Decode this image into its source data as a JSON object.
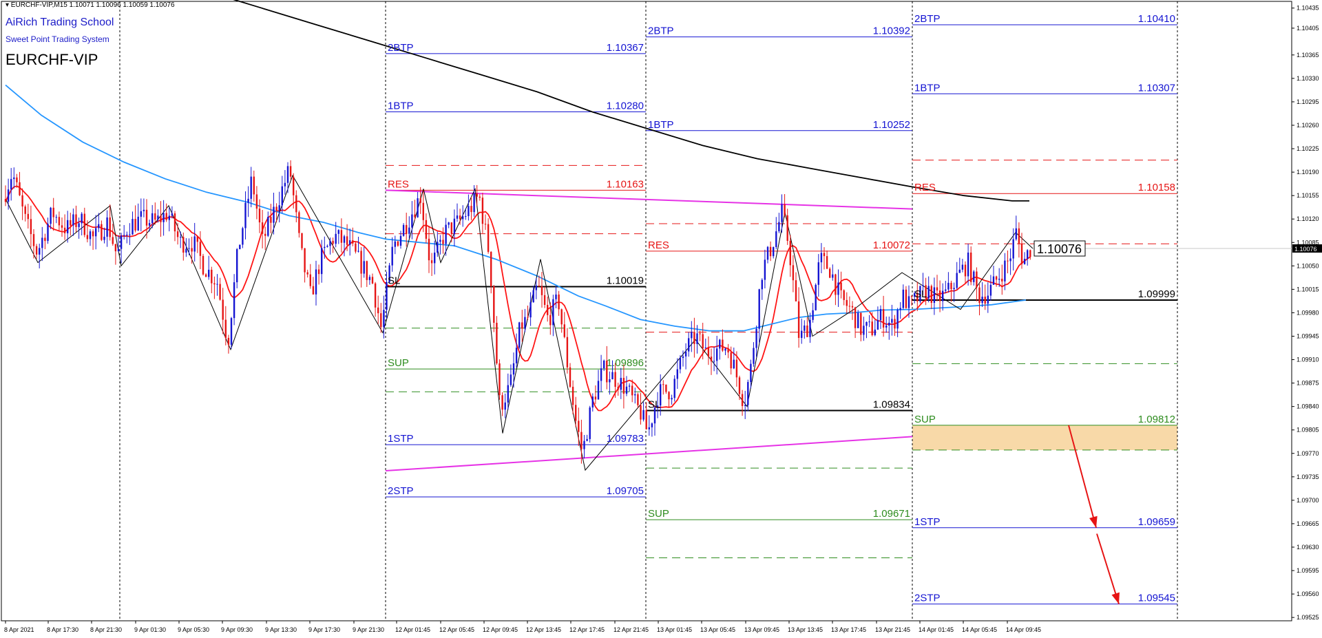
{
  "header": {
    "symbol_bar": "▾ EURCHF-VIP,M15  1.10071 1.10096 1.10059 1.10076",
    "school": "AiRich Trading School",
    "system": "Sweet Point Trading System",
    "symbol": "EURCHF-VIP"
  },
  "colors": {
    "blue_label": "#1414d2",
    "red_label": "#e61414",
    "green_label": "#2d8c1e",
    "magenta": "#e632e6",
    "ma_black": "#000000",
    "ma_blue": "#2596ff",
    "ma_red": "#ff1414",
    "candle_up": "#1414d2",
    "candle_down": "#e61414",
    "sup_zone": "#f8d9a8"
  },
  "chart_data": {
    "type": "candlestick",
    "y_range": [
      1.0952,
      1.10445
    ],
    "y_ticks": [
      "1.10435",
      "1.10405",
      "1.10365",
      "1.10330",
      "1.10295",
      "1.10260",
      "1.10225",
      "1.10190",
      "1.10155",
      "1.10120",
      "1.10085",
      "1.10050",
      "1.10015",
      "1.09980",
      "1.09945",
      "1.09910",
      "1.09875",
      "1.09840",
      "1.09805",
      "1.09770",
      "1.09735",
      "1.09700",
      "1.09665",
      "1.09630",
      "1.09595",
      "1.09560",
      "1.09525"
    ],
    "x_labels": [
      "8 Apr 2021",
      "8 Apr 17:30",
      "8 Apr 21:30",
      "9 Apr 01:30",
      "9 Apr 05:30",
      "9 Apr 09:30",
      "9 Apr 13:30",
      "9 Apr 17:30",
      "9 Apr 21:30",
      "12 Apr 01:45",
      "12 Apr 05:45",
      "12 Apr 09:45",
      "12 Apr 13:45",
      "12 Apr 17:45",
      "12 Apr 21:45",
      "13 Apr 01:45",
      "13 Apr 05:45",
      "13 Apr 09:45",
      "13 Apr 13:45",
      "13 Apr 17:45",
      "13 Apr 21:45",
      "14 Apr 01:45",
      "14 Apr 05:45",
      "14 Apr 09:45"
    ],
    "current_price": "1.10076",
    "zones": [
      {
        "x_from": "9 Apr 21:30",
        "x_to": "12 Apr 21:45",
        "levels": [
          {
            "name": "2BTP",
            "value": "1.10367",
            "price": 1.10367,
            "kind": "blue"
          },
          {
            "name": "1BTP",
            "value": "1.10280",
            "price": 1.1028,
            "kind": "blue"
          },
          {
            "name": "",
            "value": "",
            "price": 1.102,
            "kind": "red_dash"
          },
          {
            "name": "RES",
            "value": "1.10163",
            "price": 1.10163,
            "kind": "red"
          },
          {
            "name": "",
            "value": "",
            "price": 1.10098,
            "kind": "red_dash"
          },
          {
            "name": "SL",
            "value": "1.10019",
            "price": 1.10019,
            "kind": "black"
          },
          {
            "name": "",
            "value": "",
            "price": 1.09957,
            "kind": "green_dash"
          },
          {
            "name": "SUP",
            "value": "1.09896",
            "price": 1.09896,
            "kind": "green"
          },
          {
            "name": "",
            "value": "",
            "price": 1.09862,
            "kind": "green_dash"
          },
          {
            "name": "1STP",
            "value": "1.09783",
            "price": 1.09783,
            "kind": "blue"
          },
          {
            "name": "2STP",
            "value": "1.09705",
            "price": 1.09705,
            "kind": "blue"
          }
        ]
      },
      {
        "x_from": "12 Apr 21:45",
        "x_to": "13 Apr 21:45",
        "levels": [
          {
            "name": "2BTP",
            "value": "1.10392",
            "price": 1.10392,
            "kind": "blue"
          },
          {
            "name": "1BTP",
            "value": "1.10252",
            "price": 1.10252,
            "kind": "blue"
          },
          {
            "name": "",
            "value": "",
            "price": 1.10113,
            "kind": "red_dash"
          },
          {
            "name": "RES",
            "value": "1.10072",
            "price": 1.10072,
            "kind": "red"
          },
          {
            "name": "",
            "value": "",
            "price": 1.09951,
            "kind": "red_dash"
          },
          {
            "name": "SL",
            "value": "1.09834",
            "price": 1.09834,
            "kind": "black"
          },
          {
            "name": "",
            "value": "",
            "price": 1.09748,
            "kind": "green_dash"
          },
          {
            "name": "SUP",
            "value": "1.09671",
            "price": 1.09671,
            "kind": "green"
          },
          {
            "name": "",
            "value": "",
            "price": 1.09614,
            "kind": "green_dash"
          }
        ]
      },
      {
        "x_from": "13 Apr 21:45",
        "x_to": "14 Apr 13:45",
        "levels": [
          {
            "name": "2BTP",
            "value": "1.10410",
            "price": 1.1041,
            "kind": "blue"
          },
          {
            "name": "1BTP",
            "value": "1.10307",
            "price": 1.10307,
            "kind": "blue"
          },
          {
            "name": "",
            "value": "",
            "price": 1.10208,
            "kind": "red_dash"
          },
          {
            "name": "RES",
            "value": "1.10158",
            "price": 1.10158,
            "kind": "red"
          },
          {
            "name": "",
            "value": "",
            "price": 1.10083,
            "kind": "red_dash"
          },
          {
            "name": "SL",
            "value": "1.09999",
            "price": 1.09999,
            "kind": "black"
          },
          {
            "name": "",
            "value": "",
            "price": 1.09904,
            "kind": "green_dash"
          },
          {
            "name": "SUP",
            "value": "1.09812",
            "price": 1.09812,
            "kind": "green_zone"
          },
          {
            "name": "",
            "value": "",
            "price": 1.09775,
            "kind": "green_dash"
          },
          {
            "name": "1STP",
            "value": "1.09659",
            "price": 1.09659,
            "kind": "blue"
          },
          {
            "name": "2STP",
            "value": "1.09545",
            "price": 1.09545,
            "kind": "blue"
          }
        ]
      }
    ]
  }
}
